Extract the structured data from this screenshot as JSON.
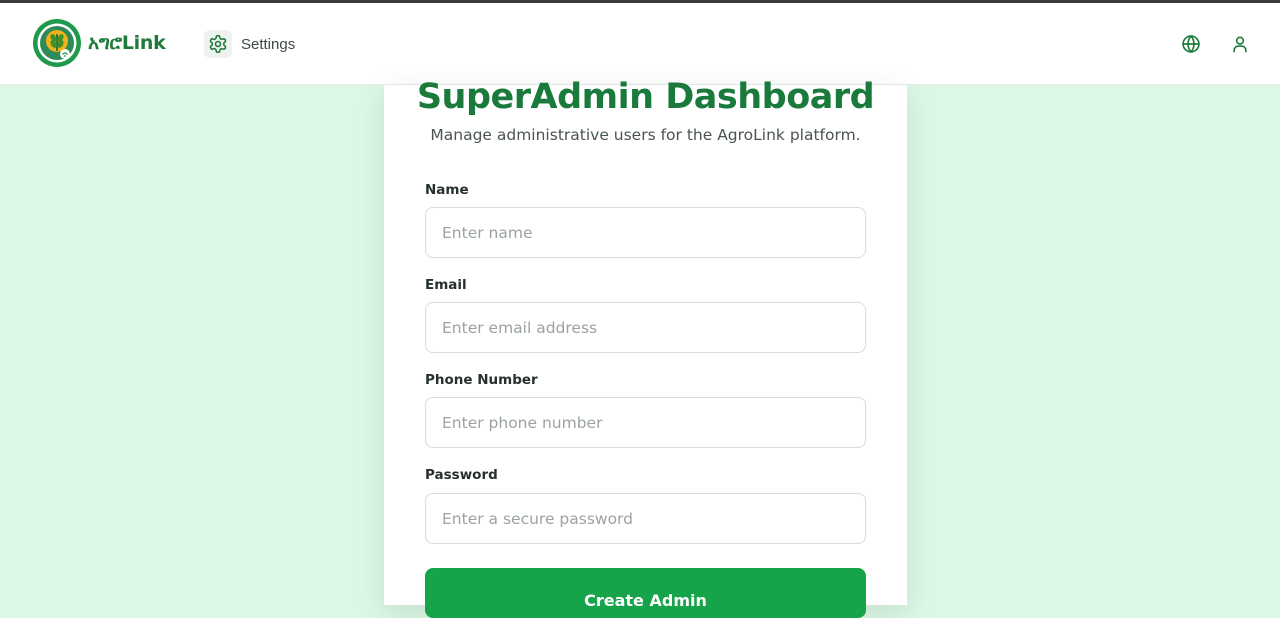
{
  "header": {
    "brand": "አግሮLink",
    "nav_settings": "Settings"
  },
  "dashboard": {
    "title": "SuperAdmin Dashboard",
    "subtitle": "Manage administrative users for the AgroLink platform."
  },
  "form": {
    "name_label": "Name",
    "name_placeholder": "Enter name",
    "email_label": "Email",
    "email_placeholder": "Enter email address",
    "phone_label": "Phone Number",
    "phone_placeholder": "Enter phone number",
    "password_label": "Password",
    "password_placeholder": "Enter a secure password",
    "submit_label": "Create Admin"
  },
  "colors": {
    "brand_green": "#1a7a3c",
    "button_green": "#16a34a",
    "page_background": "#dcf7e6"
  },
  "icons": [
    "agrolink-logo",
    "gear-icon",
    "globe-icon",
    "user-icon"
  ]
}
